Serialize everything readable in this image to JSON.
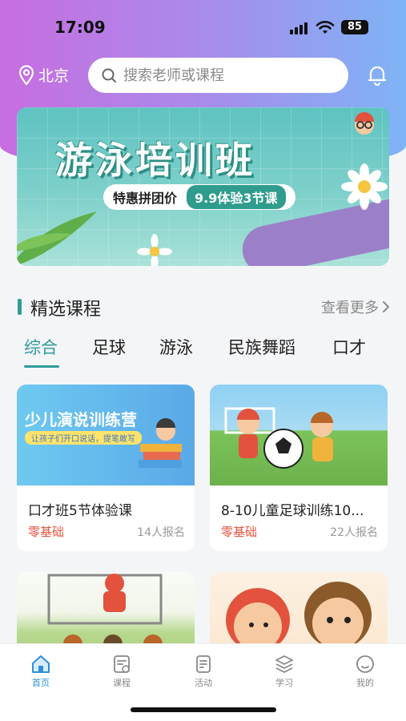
{
  "status": {
    "time": "17:09",
    "battery": "85"
  },
  "location": {
    "label": "北京"
  },
  "search": {
    "placeholder": "搜索老师或课程"
  },
  "banner": {
    "title": "游泳培训班",
    "promo_left": "特惠拼团价",
    "promo_right": "9.9体验3节课"
  },
  "section": {
    "title": "精选课程",
    "more": "查看更多"
  },
  "tabs": [
    {
      "label": "综合"
    },
    {
      "label": "足球"
    },
    {
      "label": "游泳"
    },
    {
      "label": "民族舞蹈"
    },
    {
      "label": "口才"
    }
  ],
  "courses": [
    {
      "title": "口才班5节体验课",
      "tag": "零基础",
      "count": "14人报名",
      "image_title": "少儿演说训练营",
      "image_sub": "让孩子们开口说话，提笔敢写"
    },
    {
      "title": "8-10儿童足球训练10...",
      "tag": "零基础",
      "count": "22人报名"
    },
    {
      "title": "",
      "tag": "",
      "count": ""
    },
    {
      "title": "",
      "tag": "",
      "count": ""
    }
  ],
  "nav": [
    {
      "label": "首页",
      "icon": "home-icon"
    },
    {
      "label": "课程",
      "icon": "course-icon"
    },
    {
      "label": "活动",
      "icon": "activity-icon"
    },
    {
      "label": "学习",
      "icon": "study-icon"
    },
    {
      "label": "我的",
      "icon": "profile-icon"
    }
  ],
  "colors": {
    "accent": "#2f9c9a",
    "tag": "#e8543f",
    "nav_active": "#2f8fd8"
  }
}
